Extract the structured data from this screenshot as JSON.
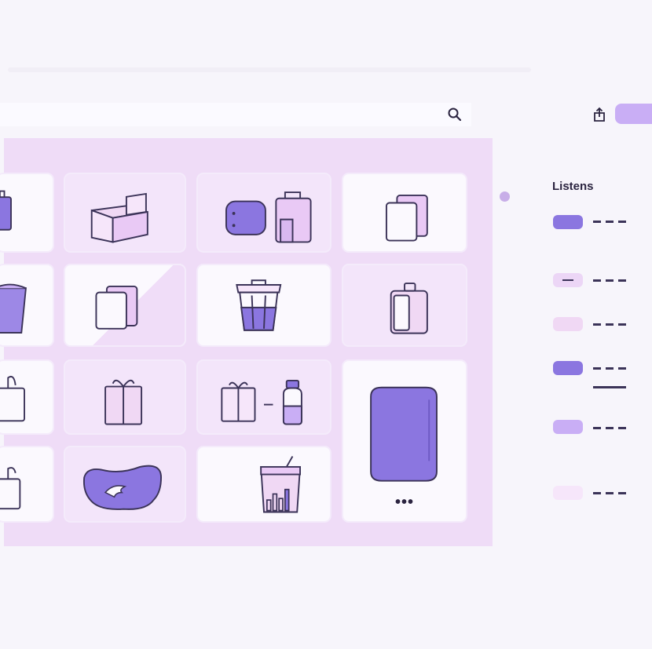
{
  "sidebar": {
    "title": "Listens",
    "items": [
      {
        "swatch_color": "#8b76e0"
      },
      {
        "swatch_color": "#ecd6f6"
      },
      {
        "swatch_color": "#f0d8f4"
      },
      {
        "swatch_color": "#8b76e0"
      },
      {
        "swatch_color": "#c9aef5"
      },
      {
        "swatch_color": "#f6e6fa"
      }
    ]
  },
  "grid": {
    "more_label": "•••",
    "icons": [
      "bag-icon",
      "box-icon",
      "pouch-and-bag-icon",
      "stacked-cards-icon",
      "basket-icon",
      "stacked-cards-icon",
      "trash-bin-icon",
      "jar-icon",
      "tote-bag-icon",
      "gift-box-icon",
      "gift-and-bottle-icon",
      "cushion-icon",
      "handbag-icon",
      "blob-mat-icon",
      "cup-bin-icon"
    ]
  },
  "colors": {
    "accent": "#8b76e0",
    "lavender": "#c9aef5",
    "panel": "#efdcf7",
    "outline": "#3b3358"
  }
}
